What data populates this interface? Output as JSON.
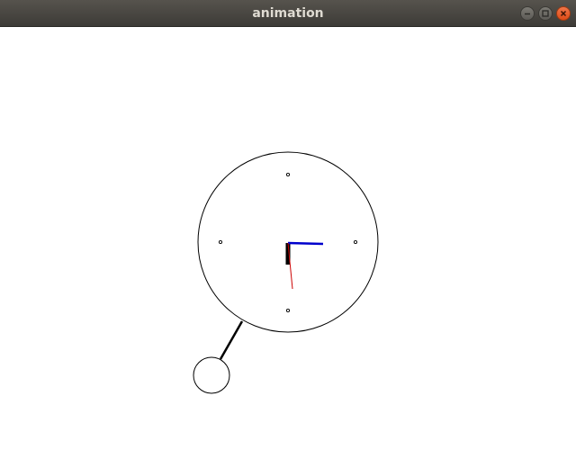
{
  "window": {
    "title": "animation",
    "controls": [
      "minimize",
      "maximize",
      "close"
    ]
  },
  "scene": {
    "description_icons": [
      "clock-face",
      "pendulum"
    ],
    "colors": {
      "hour_hand": "#000000",
      "minute_hand": "#0000cc",
      "second_hand": "#cc0000",
      "outline": "#000000",
      "close_button": "#df4b16"
    }
  }
}
